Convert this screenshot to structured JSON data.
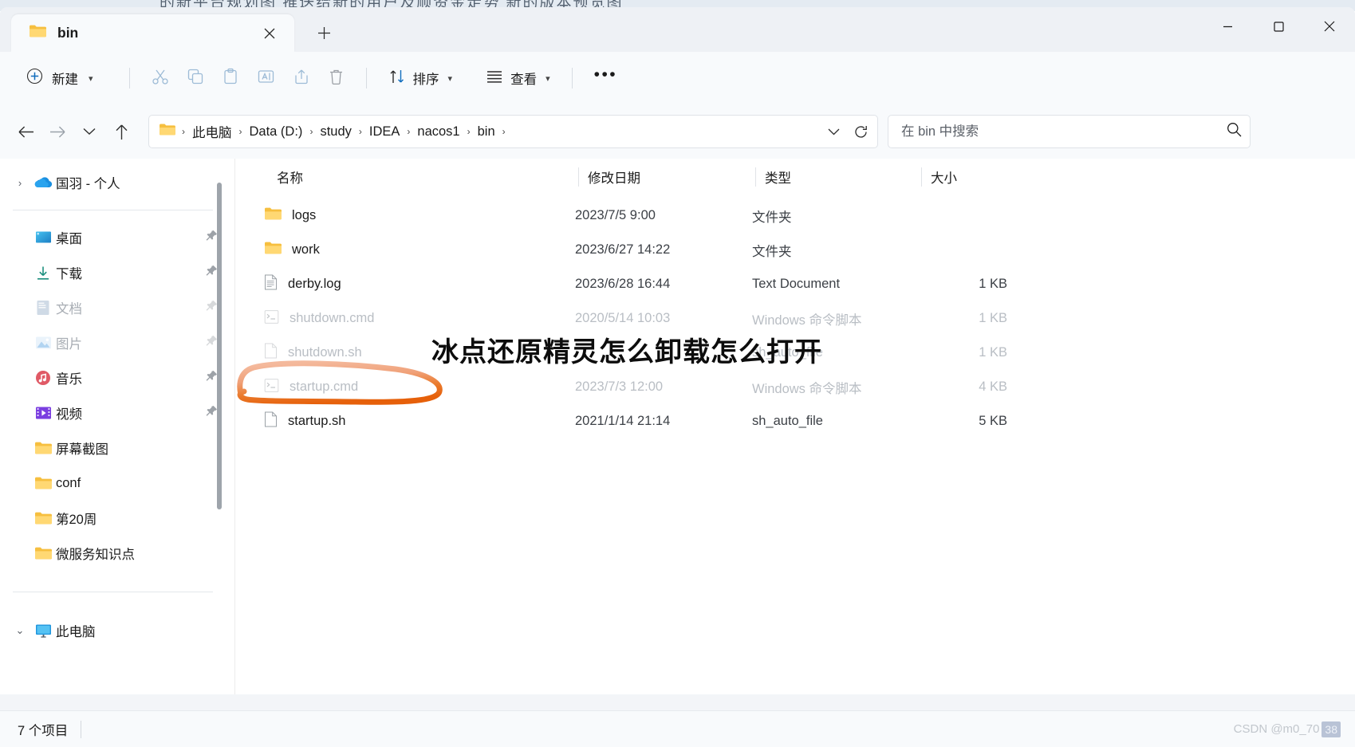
{
  "behind": {
    "text": "的新平台规划图    推送给新的用户及顺资金走势    新的版本预览图"
  },
  "titlebar": {
    "tab_label": "bin",
    "tab_icon": "folder-icon",
    "close_tab_icon": "close-icon",
    "new_tab_icon": "plus-icon",
    "minimize_icon": "minimize-icon",
    "maximize_icon": "maximize-icon",
    "close_icon": "close-icon"
  },
  "toolbar": {
    "new_label": "新建",
    "new_icon": "plus-circle-icon",
    "cut_icon": "scissors-icon",
    "copy_icon": "copy-icon",
    "paste_icon": "clipboard-icon",
    "rename_icon": "rename-icon",
    "share_icon": "share-icon",
    "delete_icon": "trash-icon",
    "sort_label": "排序",
    "sort_icon": "sort-arrows-icon",
    "view_label": "查看",
    "view_icon": "list-lines-icon",
    "more_label": "•••"
  },
  "addressbar": {
    "back_icon": "arrow-left-icon",
    "forward_icon": "arrow-right-icon",
    "recent_icon": "chevron-down-icon",
    "up_icon": "arrow-up-icon",
    "path_icon": "folder-icon",
    "crumbs": [
      "此电脑",
      "Data (D:)",
      "study",
      "IDEA",
      "nacos1",
      "bin"
    ],
    "separator": "›",
    "dropdown_icon": "chevron-down-icon",
    "refresh_icon": "refresh-icon"
  },
  "search": {
    "placeholder": "在 bin 中搜索",
    "value": "",
    "icon": "search-icon"
  },
  "sidebar": {
    "items": [
      {
        "label": "国羽 - 个人",
        "icon": "onedrive-cloud-icon",
        "chevron": "›",
        "pinned": false,
        "faded": false,
        "type": "cloud"
      },
      {
        "divider": true
      },
      {
        "label": "桌面",
        "icon": "desktop-icon",
        "pinned": true,
        "faded": false,
        "type": "desktop"
      },
      {
        "label": "下载",
        "icon": "download-icon",
        "pinned": true,
        "faded": false,
        "type": "download"
      },
      {
        "label": "文档",
        "icon": "documents-icon",
        "pinned": true,
        "faded": true,
        "type": "doc"
      },
      {
        "label": "图片",
        "icon": "pictures-icon",
        "pinned": true,
        "faded": true,
        "type": "pic"
      },
      {
        "label": "音乐",
        "icon": "music-icon",
        "pinned": true,
        "faded": false,
        "type": "music"
      },
      {
        "label": "视频",
        "icon": "videos-icon",
        "pinned": true,
        "faded": false,
        "type": "video"
      },
      {
        "label": "屏幕截图",
        "icon": "folder-icon",
        "pinned": false,
        "faded": false,
        "type": "folder"
      },
      {
        "label": "conf",
        "icon": "folder-icon",
        "pinned": false,
        "faded": false,
        "type": "folder"
      },
      {
        "label": "第20周",
        "icon": "folder-icon",
        "pinned": false,
        "faded": false,
        "type": "folder"
      },
      {
        "label": "微服务知识点",
        "icon": "folder-icon",
        "pinned": false,
        "faded": false,
        "type": "folder"
      },
      {
        "divider": true
      },
      {
        "label": "此电脑",
        "icon": "this-pc-icon",
        "chevron": "⌄",
        "pinned": false,
        "faded": false,
        "type": "thispc"
      }
    ]
  },
  "filelist": {
    "columns": [
      "名称",
      "修改日期",
      "类型",
      "大小"
    ],
    "sort_column": "名称",
    "sort_direction": "ascending",
    "sort_caret": "⌃",
    "rows": [
      {
        "name": "logs",
        "date": "2023/7/5 9:00",
        "type": "文件夹",
        "size": "",
        "icon": "folder-icon",
        "faded": false
      },
      {
        "name": "work",
        "date": "2023/6/27 14:22",
        "type": "文件夹",
        "size": "",
        "icon": "folder-icon",
        "faded": false
      },
      {
        "name": "derby.log",
        "date": "2023/6/28 16:44",
        "type": "Text Document",
        "size": "1 KB",
        "icon": "text-file-icon",
        "faded": false
      },
      {
        "name": "shutdown.cmd",
        "date": "2020/5/14 10:03",
        "type": "Windows 命令脚本",
        "size": "1 KB",
        "icon": "cmd-file-icon",
        "faded": true
      },
      {
        "name": "shutdown.sh",
        "date": "",
        "type": "sh_auto_file",
        "size": "1 KB",
        "icon": "blank-file-icon",
        "faded": true
      },
      {
        "name": "startup.cmd",
        "date": "2023/7/3 12:00",
        "type": "Windows 命令脚本",
        "size": "4 KB",
        "icon": "cmd-file-icon",
        "faded": true
      },
      {
        "name": "startup.sh",
        "date": "2021/1/14 21:14",
        "type": "sh_auto_file",
        "size": "5 KB",
        "icon": "blank-file-icon",
        "faded": false
      }
    ]
  },
  "statusbar": {
    "item_count": "7 个项目",
    "watermark": "CSDN @m0_70",
    "watermark_badge": "38"
  },
  "annotations": {
    "overlay_title": "冰点还原精灵怎么卸载怎么打开",
    "circle_target": "startup.cmd",
    "circle_color_light": "#f0a784",
    "circle_color_dark": "#e8600d"
  },
  "colors": {
    "accent": "#0f6cbd",
    "folder": "#ffcf5c",
    "window_bg": "#f8fafc",
    "titlebar_bg": "#eef1f5"
  }
}
